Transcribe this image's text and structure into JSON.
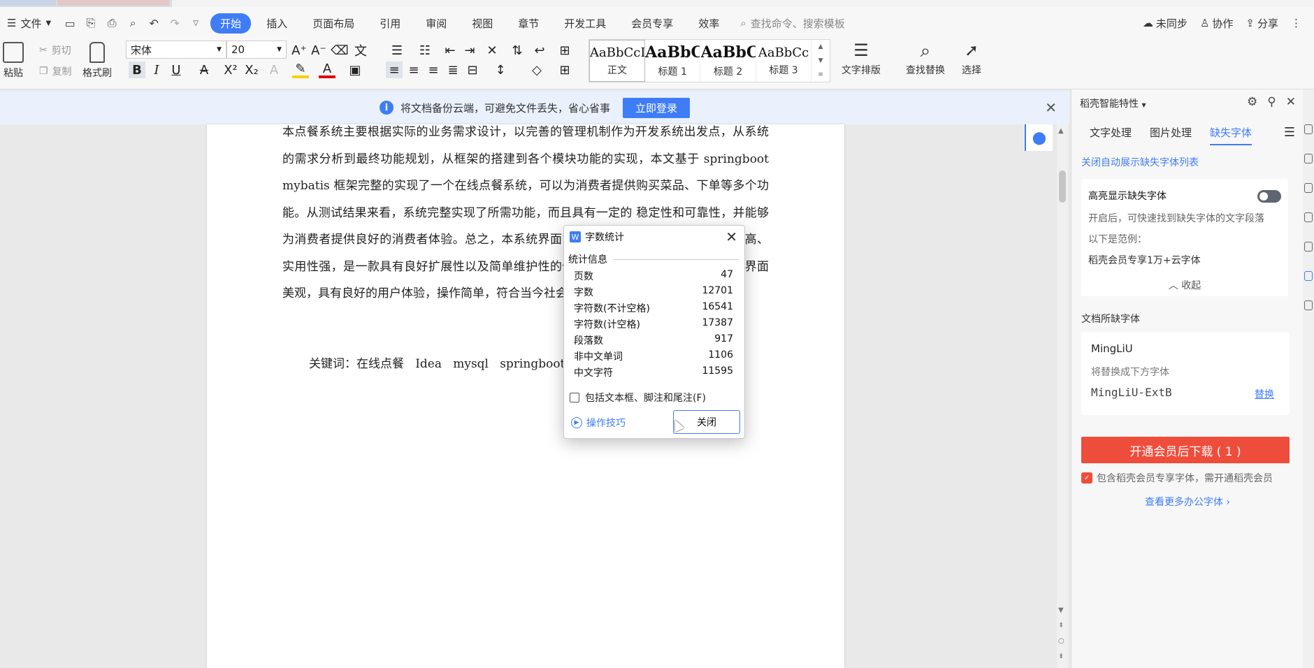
{
  "menubar": {
    "file": "文件",
    "tabs": [
      "开始",
      "插入",
      "页面布局",
      "引用",
      "审阅",
      "视图",
      "章节",
      "开发工具",
      "会员专享",
      "效率"
    ],
    "search_placeholder": "查找命令、搜索模板",
    "sync": "未同步",
    "collab": "协作",
    "share": "分享"
  },
  "ribbon": {
    "paste": "粘贴",
    "cut": "剪切",
    "copy": "复制",
    "format_painter": "格式刷",
    "font_name": "宋体",
    "font_size": "20",
    "styles": [
      {
        "preview": "AaBbCcDd",
        "label": "正文"
      },
      {
        "preview": "AaBbC",
        "label": "标题 1"
      },
      {
        "preview": "AaBbC",
        "label": "标题 2"
      },
      {
        "preview": "AaBbCc",
        "label": "标题 3"
      }
    ],
    "text_layout": "文字排版",
    "find_replace": "查找替换",
    "select": "选择"
  },
  "notice": {
    "text": "将文档备份云端，可避免文件丢失，省心省事",
    "login": "立即登录"
  },
  "document": {
    "paragraph": "本点餐系统主要根据实际的业务需求设计，以完善的管理机制作为开发系统出发点，从系统的需求分析到最终功能规划，从框架的搭建到各个模块功能的实现，本文基于 springboot mybatis 框架完整的实现了一个在线点餐系统，可以为消费者提供购买菜品、下单等多个功能。从测试结果来看，系统完整实现了所需功能，而且具有一定的 稳定性和可靠性，并能够为消费者提供良好的消费者体验。总之，本系统界面简洁、易操作、功能较多、安全性高、实用性强，是一款具有良好扩展性以及简单维护性的信息管理系统。该系统功能齐全，界面美观，具有良好的用户体验，操作简单，符合当今社会的发展趋势。",
    "keywords": "关键词：在线点餐   Idea   mysql   springboot"
  },
  "dialog": {
    "title": "字数统计",
    "section": "统计信息",
    "stats": [
      {
        "label": "页数",
        "value": "47"
      },
      {
        "label": "字数",
        "value": "12701"
      },
      {
        "label": "字符数(不计空格)",
        "value": "16541"
      },
      {
        "label": "字符数(计空格)",
        "value": "17387"
      },
      {
        "label": "段落数",
        "value": "917"
      },
      {
        "label": "非中文单词",
        "value": "1106"
      },
      {
        "label": "中文字符",
        "value": "11595"
      }
    ],
    "checkbox": "包括文本框、脚注和尾注(F)",
    "tips": "操作技巧",
    "close": "关闭"
  },
  "panel": {
    "header": "稻壳智能特性",
    "tabs": [
      "文字处理",
      "图片处理",
      "缺失字体"
    ],
    "auto_link": "关闭自动展示缺失字体列表",
    "highlight_title": "高亮显示缺失字体",
    "highlight_desc": "开启后，可快速找到缺失字体的文字段落",
    "example_label": "以下是范例：",
    "example": "稻壳会员专享1万+云字体",
    "collapse": "收起",
    "missing_title": "文档所缺字体",
    "missing_font": "MingLiU",
    "replace_hint": "将替换成下方字体",
    "replacement_font": "MingLiU-ExtB",
    "replace": "替换",
    "download": "开通会员后下载 ( 1 )",
    "download_note": "包含稻壳会员专享字体，需开通稻壳会员",
    "more": "查看更多办公字体"
  }
}
